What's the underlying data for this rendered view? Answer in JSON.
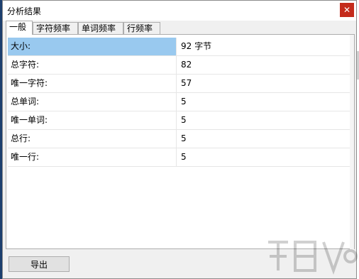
{
  "window": {
    "title": "分析结果",
    "close_glyph": "✕"
  },
  "tabs": [
    {
      "label": "一般",
      "active": true
    },
    {
      "label": "字符频率",
      "active": false
    },
    {
      "label": "单词频率",
      "active": false
    },
    {
      "label": "行频率",
      "active": false
    }
  ],
  "rows": [
    {
      "label": "大小:",
      "value": "92 字节"
    },
    {
      "label": "总字符:",
      "value": "82"
    },
    {
      "label": "唯一字符:",
      "value": "57"
    },
    {
      "label": "总单词:",
      "value": "5"
    },
    {
      "label": "唯一单词:",
      "value": "5"
    },
    {
      "label": "总行:",
      "value": "5"
    },
    {
      "label": "唯一行:",
      "value": "5"
    }
  ],
  "footer": {
    "export_label": "导出"
  },
  "colors": {
    "selection": "#99c9ef",
    "close": "#c42b1c"
  },
  "watermark": "logo-watermark"
}
